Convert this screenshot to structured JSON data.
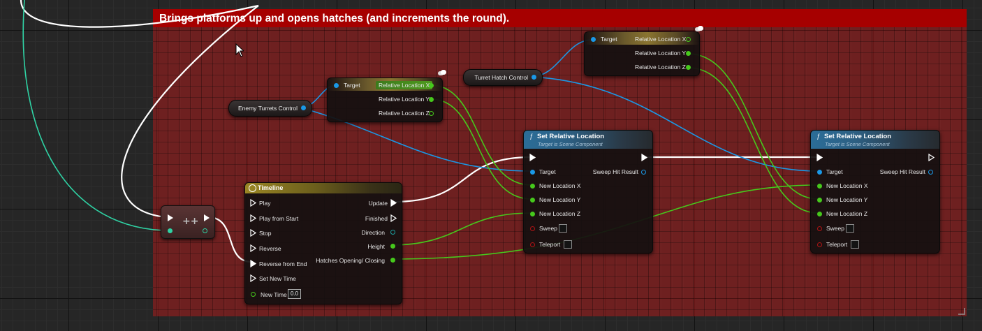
{
  "comment": {
    "text": "Brings platforms up and opens hatches (and increments the round).",
    "color": "#a60000"
  },
  "variables": {
    "enemy_turrets": "Enemy Turrets Control",
    "turret_hatch": "Turret Hatch Control"
  },
  "break_node_1": {
    "target": "Target",
    "x": "Relative Location X",
    "y": "Relative Location Y",
    "z": "Relative Location Z"
  },
  "break_node_2": {
    "target": "Target",
    "x": "Relative Location X",
    "y": "Relative Location Y",
    "z": "Relative Location Z"
  },
  "timeline": {
    "title": "Timeline",
    "inputs": [
      "Play",
      "Play from Start",
      "Stop",
      "Reverse",
      "Reverse from End",
      "Set New Time"
    ],
    "new_time_label": "New Time",
    "new_time_value": "0.0",
    "outputs": [
      "Update",
      "Finished",
      "Direction",
      "Height",
      "Hatches Opening/ Closing"
    ]
  },
  "increment": {
    "symbol": "++",
    "icon": "increment-icon"
  },
  "set_loc_1": {
    "title": "Set Relative Location",
    "subtitle": "Target is Scene Component",
    "target": "Target",
    "x": "New Location X",
    "y": "New Location Y",
    "z": "New Location Z",
    "sweep": "Sweep",
    "teleport": "Teleport",
    "sweep_hit": "Sweep Hit Result"
  },
  "set_loc_2": {
    "title": "Set Relative Location",
    "subtitle": "Target is Scene Component",
    "target": "Target",
    "x": "New Location X",
    "y": "New Location Y",
    "z": "New Location Z",
    "sweep": "Sweep",
    "teleport": "Teleport",
    "sweep_hit": "Sweep Hit Result"
  },
  "colors": {
    "exec": "#ffffff",
    "object": "#1a98e6",
    "float": "#46c81c",
    "integer": "#2fd2a4",
    "struct": "#b01414"
  }
}
